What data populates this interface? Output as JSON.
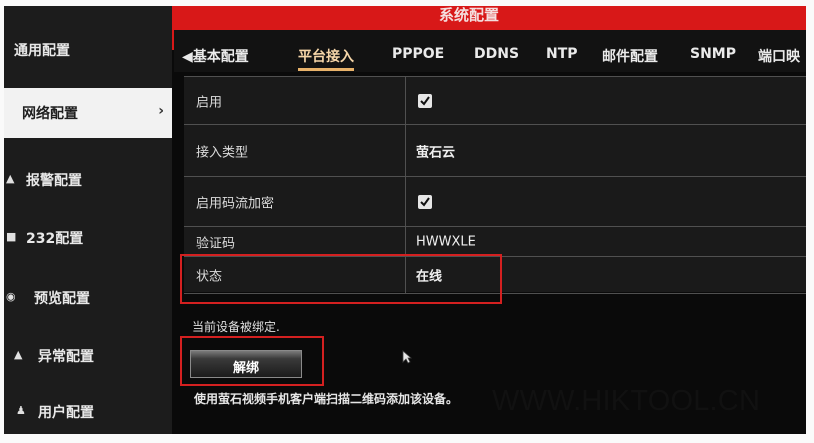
{
  "window": {
    "title": "系统配置"
  },
  "sidebar": {
    "items": [
      {
        "label": "通用配置",
        "icon": "none"
      },
      {
        "label": "网络配置",
        "icon": "none",
        "active": true
      },
      {
        "label": "报警配置",
        "icon": "warning-icon"
      },
      {
        "label": "232配置",
        "icon": "serial-icon"
      },
      {
        "label": "预览配置",
        "icon": "eye-icon"
      },
      {
        "label": "异常配置",
        "icon": "alert-icon"
      },
      {
        "label": "用户配置",
        "icon": "user-icon"
      }
    ]
  },
  "tabs": {
    "back_label": "基本配置",
    "items": [
      "平台接入",
      "PPPOE",
      "DDNS",
      "NTP",
      "邮件配置",
      "SNMP",
      "端口映"
    ],
    "active_index": 0
  },
  "form": {
    "rows": [
      {
        "label": "启用",
        "type": "checkbox",
        "checked": true
      },
      {
        "label": "接入类型",
        "value": "萤石云"
      },
      {
        "label": "启用码流加密",
        "type": "checkbox",
        "checked": true
      },
      {
        "label": "验证码",
        "value": "HWWXLE"
      },
      {
        "label": "状态",
        "value": "在线"
      }
    ]
  },
  "bound_note": "当前设备被绑定.",
  "unbind_button": "解绑",
  "instruction": "使用萤石视频手机客户端扫描二维码添加该设备。",
  "watermark": "WWW.HIKTOOL.CN",
  "colors": {
    "title_bar": "#d81818",
    "highlight": "#d42020",
    "active_tab": "#e8b26a"
  }
}
